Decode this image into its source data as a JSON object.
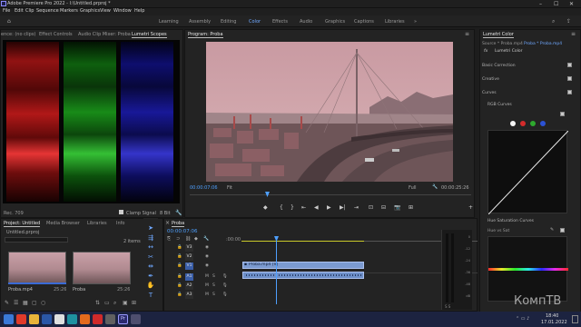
{
  "title": "Adobe Premiere Pro 2022 - I:\\Untitled.prproj *",
  "window_controls": [
    "–",
    "☐",
    "✕"
  ],
  "menu": [
    "File",
    "Edit",
    "Clip",
    "Sequence",
    "Markers",
    "Graphics",
    "View",
    "Window",
    "Help"
  ],
  "workspaces": [
    {
      "label": "Learning",
      "active": false
    },
    {
      "label": "Assembly",
      "active": false
    },
    {
      "label": "Editing",
      "active": false
    },
    {
      "label": "Color",
      "active": true
    },
    {
      "label": "Effects",
      "active": false
    },
    {
      "label": "Audio",
      "active": false
    },
    {
      "label": "Graphics",
      "active": false
    },
    {
      "label": "Captions",
      "active": false
    },
    {
      "label": "Libraries",
      "active": false
    }
  ],
  "scopes_panel": {
    "tabs": [
      "ence: (no clips)",
      "Effect Controls",
      "Audio Clip Mixer: Proba",
      "Lumetri Scopes"
    ],
    "active_tab": "Lumetri Scopes",
    "left_label": "Rec. 709",
    "clamp_signal": "Clamp Signal",
    "bit_depth": "8 Bit"
  },
  "program_monitor": {
    "title": "Program: Proba",
    "timecode": "00:00:07:06",
    "fit": "Fit",
    "quality": "Full",
    "duration": "00:00:25:26",
    "controls": [
      "◆",
      "{",
      "}",
      "⇤",
      "◀",
      "▶",
      "▶|",
      "⇥",
      "⊡",
      "⊟",
      "📷",
      "⊞",
      "+"
    ]
  },
  "lumetri": {
    "title": "Lumetri Color",
    "source": "Source * Proba.mp4",
    "target": "Proba * Proba.mp4",
    "fx": "fx",
    "effect": "Lumetri Color",
    "sections": [
      "Basic Correction",
      "Creative",
      "Curves"
    ],
    "rgb_curves": "RGB Curves",
    "hue_sat": "Hue Saturation Curves",
    "hue_vs_sat": "Hue vs Sat",
    "dot_colors": [
      "#f5f5f5",
      "#d42b2b",
      "#2ea82e",
      "#2b52d4"
    ]
  },
  "project_panel": {
    "tabs": [
      "Project: Untitled",
      "Media Browser",
      "Libraries",
      "Info"
    ],
    "file": "Untitled.prproj",
    "count": "2 items",
    "items": [
      {
        "name": "Proba.mp4",
        "duration": "25:26"
      },
      {
        "name": "Proba",
        "duration": "25:26"
      }
    ]
  },
  "timeline": {
    "title": "Proba",
    "timecode": "00:00:07:06",
    "ruler_start": ":00:00",
    "video_tracks": [
      "V3",
      "V2",
      "V1"
    ],
    "audio_tracks": [
      "A1",
      "A2",
      "A3"
    ],
    "video_clip": "Proba.mp4 [V]",
    "audio_clip": "",
    "track_flags": [
      "M",
      "S"
    ]
  },
  "audio_meter": {
    "scale": [
      "0",
      "-12",
      "-24",
      "-36",
      "-48",
      "dB"
    ],
    "bottom": "S S"
  },
  "taskbar": {
    "time": "18:40",
    "date": "17.01.2022",
    "icons": [
      {
        "name": "start",
        "color": "#3a79d8"
      },
      {
        "name": "yandex",
        "color": "#e03a2a"
      },
      {
        "name": "explorer",
        "color": "#e8b33a"
      },
      {
        "name": "word",
        "color": "#2b57a7"
      },
      {
        "name": "chrome",
        "color": "#dfdfdf"
      },
      {
        "name": "app5",
        "color": "#1e90a0"
      },
      {
        "name": "firefox",
        "color": "#e36a1d"
      },
      {
        "name": "opera",
        "color": "#cf2a2a"
      },
      {
        "name": "app8",
        "color": "#606060"
      },
      {
        "name": "premiere",
        "color": "#2a2a6e"
      },
      {
        "name": "app10",
        "color": "#4e4e6e"
      }
    ]
  },
  "watermark": "КомпТВ"
}
